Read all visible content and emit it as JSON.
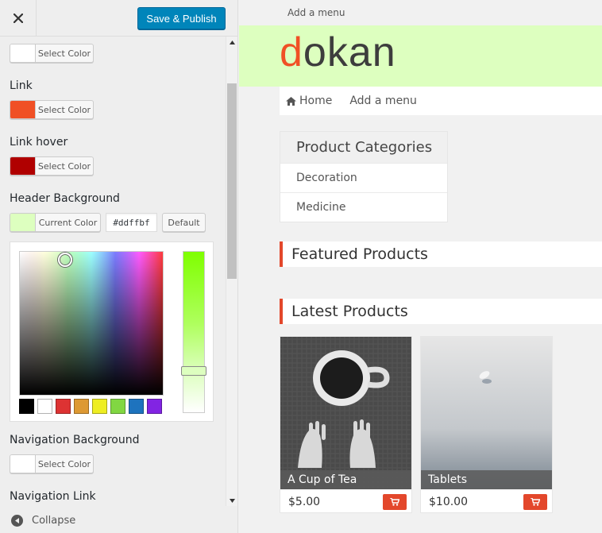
{
  "sidebar": {
    "close_label": "Close",
    "publish_label": "Save & Publish",
    "controls": {
      "first_color_button": "Select Color",
      "link": {
        "label": "Link",
        "button": "Select Color",
        "color": "#f05025"
      },
      "link_hover": {
        "label": "Link hover",
        "button": "Select Color",
        "color": "#b00000"
      },
      "header_background": {
        "label": "Header Background",
        "button": "Current Color",
        "color": "#ddffbf",
        "hex_value": "#ddffbf",
        "default_label": "Default",
        "palette": [
          "#000000",
          "#ffffff",
          "#dd3333",
          "#dd9933",
          "#eeee22",
          "#81d742",
          "#1e73be",
          "#8224e3"
        ]
      },
      "navigation_background": {
        "label": "Navigation Background",
        "button": "Select Color",
        "color": "#ffffff"
      },
      "navigation_link": {
        "label": "Navigation Link"
      }
    },
    "collapse_label": "Collapse"
  },
  "preview": {
    "admin_menu": "Add a menu",
    "logo": {
      "first": "d",
      "rest": "okan"
    },
    "nav": {
      "home": "Home",
      "add_menu": "Add a menu"
    },
    "categories": {
      "title": "Product Categories",
      "items": [
        "Decoration",
        "Medicine"
      ]
    },
    "featured_title": "Featured Products",
    "latest_title": "Latest Products",
    "products": [
      {
        "name": "A Cup of Tea",
        "price": "$5.00"
      },
      {
        "name": "Tablets",
        "price": "$10.00"
      }
    ]
  },
  "colors": {
    "accent": "#e3472b",
    "publish_blue": "#0085ba",
    "header_bg": "#ddffbf"
  },
  "icons": [
    "close-icon",
    "scroll-up-icon",
    "scroll-down-icon",
    "collapse-arrow-icon",
    "home-icon",
    "cart-icon"
  ]
}
